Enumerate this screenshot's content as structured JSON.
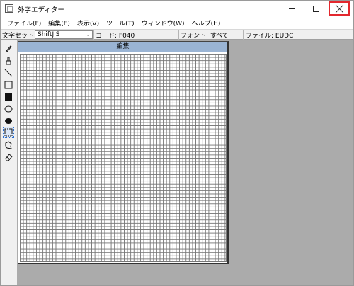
{
  "window": {
    "title": "外字エディター",
    "close_highlight_color": "#e3282e"
  },
  "menu": {
    "items": [
      {
        "label": "ファイル(F)"
      },
      {
        "label": "編集(E)"
      },
      {
        "label": "表示(V)"
      },
      {
        "label": "ツール(T)"
      },
      {
        "label": "ウィンドウ(W)"
      },
      {
        "label": "ヘルプ(H)"
      }
    ]
  },
  "infobar": {
    "charset_label": "文字セット:",
    "charset_value": "ShiftJIS",
    "code_label": "コード: F040",
    "font_label": "フォント: すべて",
    "file_label": "ファイル: EUDC"
  },
  "tools": [
    {
      "icon": "pencil-icon"
    },
    {
      "icon": "brush-icon"
    },
    {
      "icon": "line-icon"
    },
    {
      "icon": "hollow-rectangle-icon"
    },
    {
      "icon": "filled-rectangle-icon"
    },
    {
      "icon": "hollow-ellipse-icon"
    },
    {
      "icon": "filled-ellipse-icon"
    },
    {
      "icon": "rectangular-select-icon",
      "selected": true
    },
    {
      "icon": "freeform-select-icon"
    },
    {
      "icon": "eraser-icon"
    }
  ],
  "editor": {
    "header": "編集",
    "header_color": "#9ab4d4"
  }
}
